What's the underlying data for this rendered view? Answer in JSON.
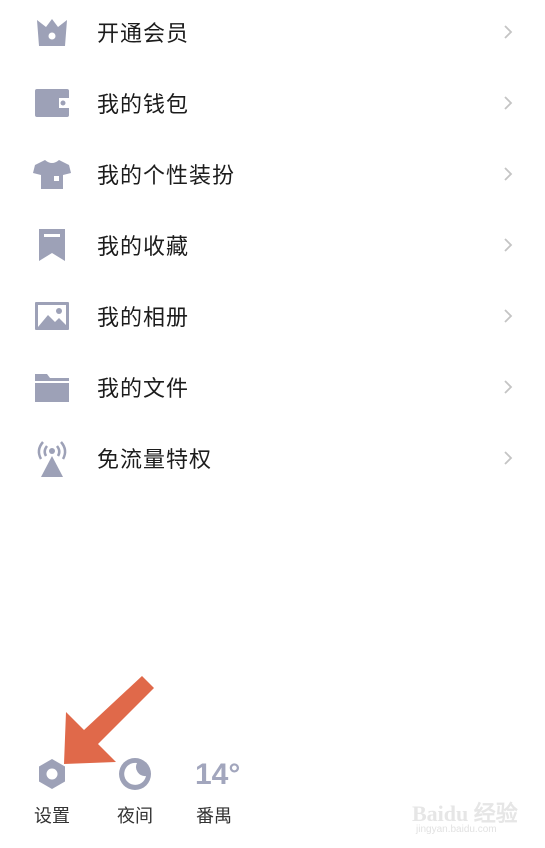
{
  "menu": {
    "items": [
      {
        "label": "开通会员",
        "icon": "crown-icon"
      },
      {
        "label": "我的钱包",
        "icon": "wallet-icon"
      },
      {
        "label": "我的个性装扮",
        "icon": "shirt-icon"
      },
      {
        "label": "我的收藏",
        "icon": "bookmark-icon"
      },
      {
        "label": "我的相册",
        "icon": "photo-icon"
      },
      {
        "label": "我的文件",
        "icon": "folder-icon"
      },
      {
        "label": "免流量特权",
        "icon": "signal-tower-icon"
      }
    ]
  },
  "bottom_bar": {
    "settings_label": "设置",
    "night_label": "夜间",
    "temperature": "14°",
    "city": "番禺"
  },
  "watermark": {
    "brand": "Baidu 经验",
    "url": "jingyan.baidu.com"
  },
  "colors": {
    "icon": "#9da1b7",
    "chevron": "#c4c4c4",
    "arrow": "#e0694a"
  }
}
